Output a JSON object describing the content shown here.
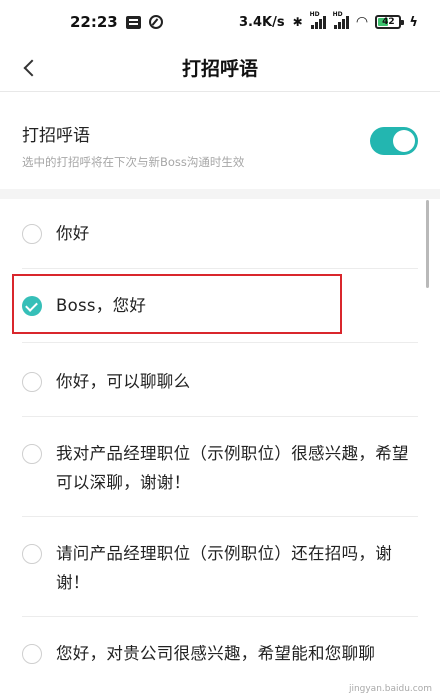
{
  "status_bar": {
    "time": "22:23",
    "network_speed": "3.4K/s",
    "signal_label": "HD",
    "battery_level": "42",
    "battery_fraction": 0.42,
    "icons": [
      "message-icon",
      "vpn-icon",
      "bluetooth-icon",
      "signal-icon",
      "wifi-icon",
      "battery-icon",
      "charging-icon"
    ]
  },
  "nav": {
    "title": "打招呼语",
    "back_icon": "chevron-left-icon"
  },
  "greeting_setting": {
    "title": "打招呼语",
    "description": "选中的打招呼将在下次与新Boss沟通时生效",
    "enabled": true,
    "accent_color": "#23b6b0"
  },
  "greetings": [
    {
      "text": "你好",
      "selected": false
    },
    {
      "text": "Boss，您好",
      "selected": true
    },
    {
      "text": "你好，可以聊聊么",
      "selected": false
    },
    {
      "text": "我对产品经理职位（示例职位）很感兴趣，希望可以深聊，谢谢！",
      "selected": false
    },
    {
      "text": "请问产品经理职位（示例职位）还在招吗，谢谢！",
      "selected": false
    },
    {
      "text": "您好，对贵公司很感兴趣，希望能和您聊聊",
      "selected": false
    }
  ],
  "highlight_color": "#d9262c",
  "watermark": "jingyan.baidu.com"
}
